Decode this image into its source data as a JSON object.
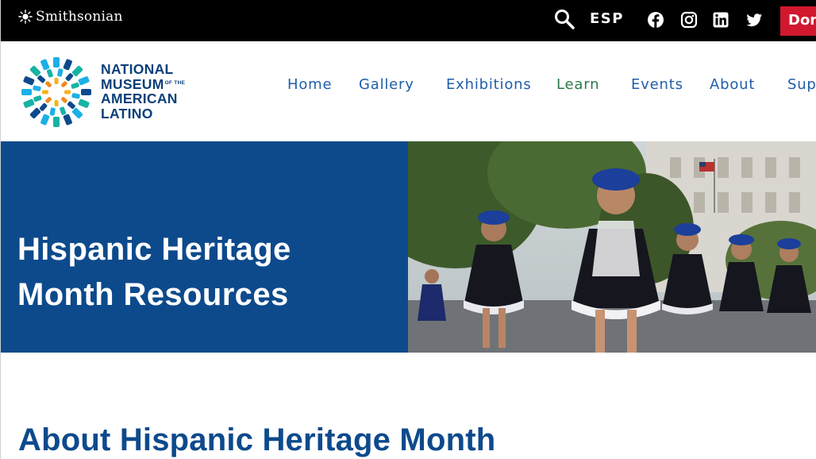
{
  "topbar": {
    "brand": "Smithsonian",
    "language_toggle": "ESP",
    "donate_label": "Donate",
    "social": [
      "facebook-icon",
      "instagram-icon",
      "linkedin-icon",
      "twitter-icon"
    ]
  },
  "header": {
    "logo_lines": [
      "NATIONAL",
      "MUSEUM",
      "AMERICAN",
      "LATINO"
    ],
    "logo_of_the": "OF THE",
    "nav": [
      {
        "label": "Home"
      },
      {
        "label": "Gallery"
      },
      {
        "label": "Exhibitions"
      },
      {
        "label": "Learn"
      },
      {
        "label": "Events"
      },
      {
        "label": "About"
      },
      {
        "label": "Support"
      }
    ]
  },
  "hero": {
    "title_line1": "Hispanic Heritage",
    "title_line2": "Month Resources"
  },
  "about": {
    "title": "About Hispanic Heritage Month"
  },
  "colors": {
    "topbar_bg": "#000000",
    "donate_bg": "#d1182f",
    "brand_blue": "#0d4a8c",
    "nav_blue": "#1f5ea9",
    "nav_active_green": "#2b7a48"
  }
}
